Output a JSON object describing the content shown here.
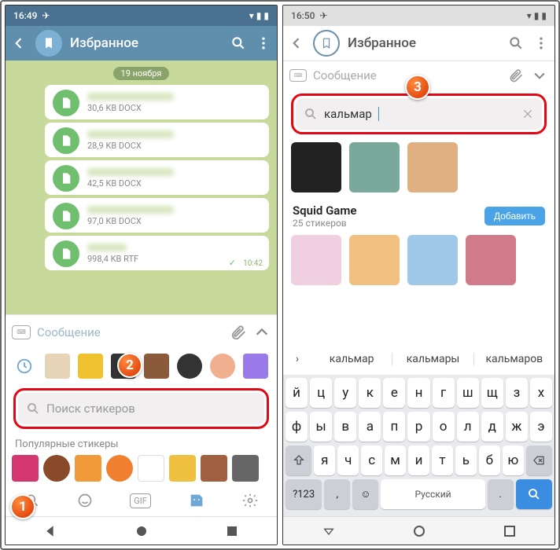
{
  "left": {
    "status_time": "16:49",
    "header_title": "Избранное",
    "date_pill": "19 ноября",
    "files": [
      {
        "meta": "30,6 KB DOCX"
      },
      {
        "meta": "28,9 KB DOCX"
      },
      {
        "meta": "42,5 KB DOCX"
      },
      {
        "meta": "97,0 KB DOCX"
      },
      {
        "meta": "998,4 KB RTF"
      }
    ],
    "msg_time": "10:42",
    "compose_placeholder": "Сообщение",
    "search_placeholder": "Поиск стикеров",
    "popular_label": "Популярные стикеры"
  },
  "right": {
    "status_time": "16:50",
    "header_title": "Избранное",
    "compose_placeholder": "Сообщение",
    "search_value": "кальмар",
    "pack_name": "Squid Game",
    "pack_count": "25 стикеров",
    "add_button": "Добавить",
    "suggestions": [
      "кальмар",
      "кальмары",
      "кальмаров"
    ],
    "kbd_row1": [
      "й",
      "ц",
      "у",
      "к",
      "е",
      "н",
      "г",
      "ш",
      "щ",
      "з",
      "х"
    ],
    "kbd_row2": [
      "ф",
      "ы",
      "в",
      "а",
      "п",
      "р",
      "о",
      "л",
      "д",
      "ж",
      "э"
    ],
    "kbd_row3": [
      "я",
      "ч",
      "с",
      "м",
      "и",
      "т",
      "ь",
      "б",
      "ю"
    ],
    "kbd_fn_numbers": "?123",
    "kbd_space": "Русский"
  },
  "badges": {
    "one": "1",
    "two": "2",
    "three": "3"
  }
}
